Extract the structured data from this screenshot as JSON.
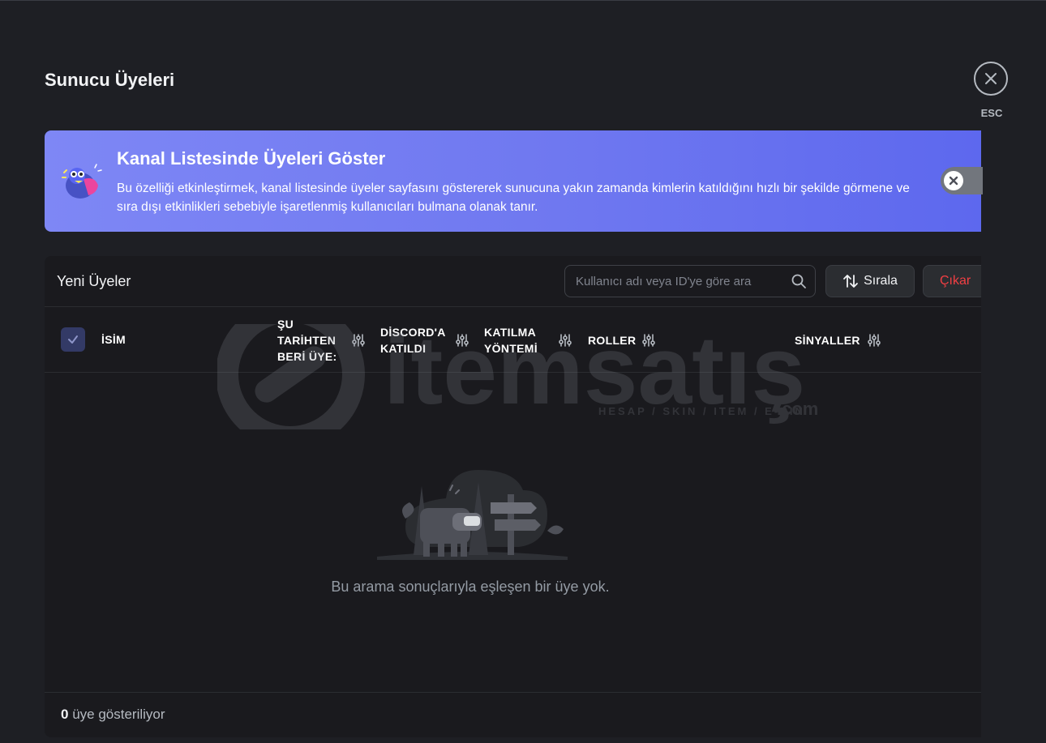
{
  "page": {
    "title": "Sunucu Üyeleri"
  },
  "close": {
    "esc_label": "ESC",
    "icon": "close-icon"
  },
  "banner": {
    "title": "Kanal Listesinde Üyeleri Göster",
    "description": "Bu özelliği etkinleştirmek, kanal listesinde üyeler sayfasını göstererek sunucuna yakın zamanda kimlerin katıldığını hızlı bir şekilde görmene ve sıra dışı etkinlikleri sebebiyle işaretlenmiş kullanıcıları bulmana olanak tanır.",
    "toggle_state": "off"
  },
  "members": {
    "title": "Yeni Üyeler",
    "search_placeholder": "Kullanıcı adı veya ID'ye göre ara",
    "sort_label": "Sırala",
    "remove_label": "Çıkar",
    "columns": {
      "name": "İSİM",
      "member_since_1": "ŞU",
      "member_since_2": "TARİHTEN",
      "member_since_3": "BERİ ÜYE:",
      "joined_discord_1": "DİSCORD'A",
      "joined_discord_2": "KATILDI",
      "join_method_1": "KATILMA",
      "join_method_2": "YÖNTEMİ",
      "roles": "ROLLER",
      "signals": "SİNYALLER"
    },
    "empty_message": "Bu arama sonuçlarıyla eşleşen bir üye yok.",
    "footer_count": "0",
    "footer_label": "üye gösteriliyor"
  },
  "watermark": {
    "text": "itemsatış",
    "tagline": "HESAP / SKIN / ITEM / E-PIN",
    "suffix": ".com"
  },
  "colors": {
    "background": "#1e1f24",
    "banner": "#6f78f0",
    "danger": "#f23f43",
    "checkbox": "#333a66"
  }
}
